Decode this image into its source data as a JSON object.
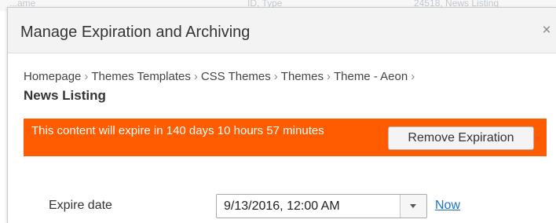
{
  "background": {
    "fragments": [
      "...ame",
      "ID, Type",
      "24518, News Listing"
    ]
  },
  "dialog": {
    "title": "Manage Expiration and Archiving",
    "close_icon_glyph": "×"
  },
  "breadcrumb": {
    "items": [
      "Homepage",
      "Themes Templates",
      "CSS Themes",
      "Themes",
      "Theme - Aeon"
    ],
    "separator": "›",
    "current": "News Listing"
  },
  "alert": {
    "message": "This content will expire in 140 days 10 hours 57 minutes",
    "button_label": "Remove Expiration",
    "color": "#ff5b00"
  },
  "expire": {
    "label": "Expire date",
    "value": "9/13/2016, 12:00 AM",
    "now_label": "Now"
  },
  "colors": {
    "link": "#1a73c6",
    "alert_bg": "#ff5b00",
    "header_bg": "#f3f3f3"
  }
}
